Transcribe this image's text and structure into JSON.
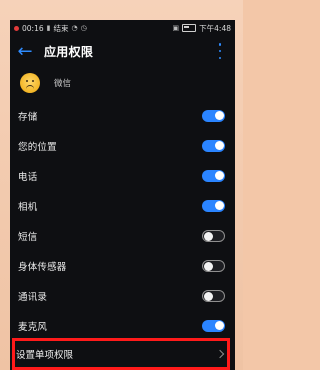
{
  "status_bar": {
    "time": "00:16",
    "network_text": "结束",
    "battery_time": "下午4:48"
  },
  "header": {
    "title": "应用权限"
  },
  "app": {
    "name": "微信"
  },
  "permissions": [
    {
      "label": "存储",
      "enabled": true
    },
    {
      "label": "您的位置",
      "enabled": true
    },
    {
      "label": "电话",
      "enabled": true
    },
    {
      "label": "相机",
      "enabled": true
    },
    {
      "label": "短信",
      "enabled": false
    },
    {
      "label": "身体传感器",
      "enabled": false
    },
    {
      "label": "通讯录",
      "enabled": false
    },
    {
      "label": "麦克风",
      "enabled": true
    }
  ],
  "single_permission": {
    "label": "设置单项权限"
  },
  "colors": {
    "accent": "#2a84ff",
    "highlight": "#ff1a1a",
    "background": "#0e0f12"
  }
}
